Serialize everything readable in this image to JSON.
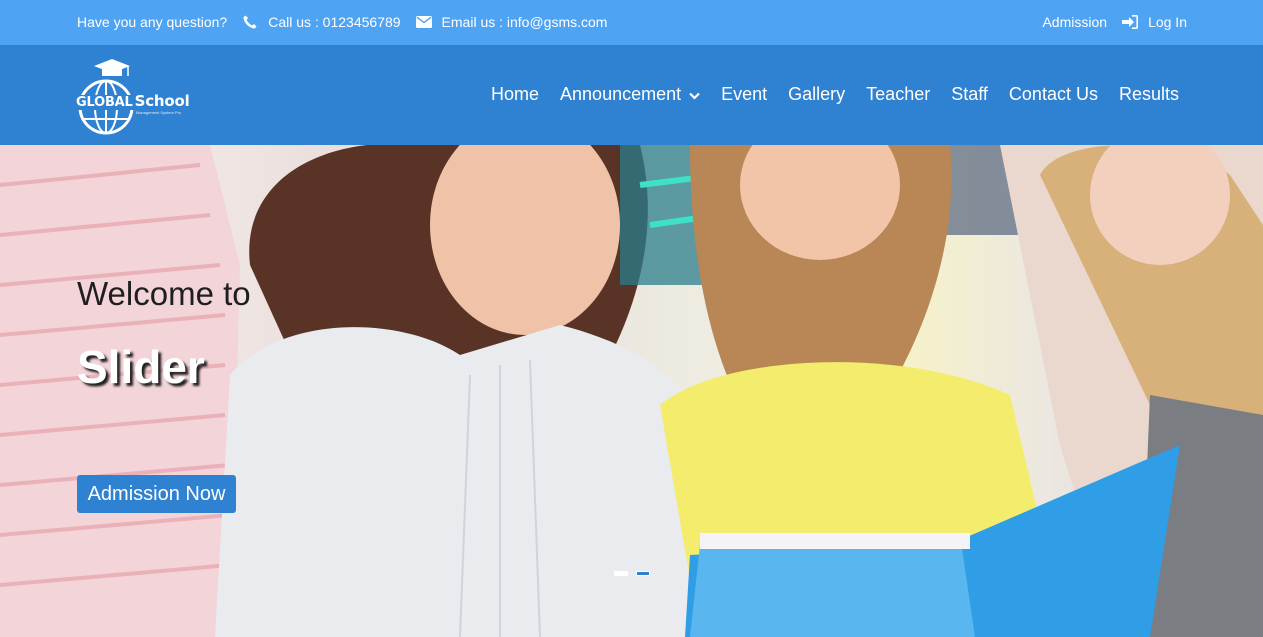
{
  "topbar": {
    "question": "Have you any question?",
    "phone": "Call us : 0123456789",
    "email": "Email us : info@gsms.com",
    "admission": "Admission",
    "login": "Log In",
    "background": "#4fa3f3"
  },
  "brand": {
    "name_part1": "GLOBAL",
    "name_part2": "School",
    "tagline": "Management System Pro"
  },
  "nav": {
    "items": [
      {
        "label": "Home"
      },
      {
        "label": "Announcement"
      },
      {
        "label": "Event"
      },
      {
        "label": "Gallery"
      },
      {
        "label": "Teacher"
      },
      {
        "label": "Staff"
      },
      {
        "label": "Contact Us"
      },
      {
        "label": "Results"
      }
    ],
    "background": "#2f81d2"
  },
  "hero": {
    "welcome": "Welcome to",
    "title": "Slider",
    "button": "Admission Now",
    "slides": 2,
    "active_slide": 1
  },
  "colors": {
    "accent": "#2f81d2",
    "topbar": "#4fa3f3"
  },
  "icons": [
    "phone-icon",
    "envelope-icon",
    "login-icon",
    "chevron-down-icon",
    "graduation-cap-icon",
    "globe-icon"
  ]
}
